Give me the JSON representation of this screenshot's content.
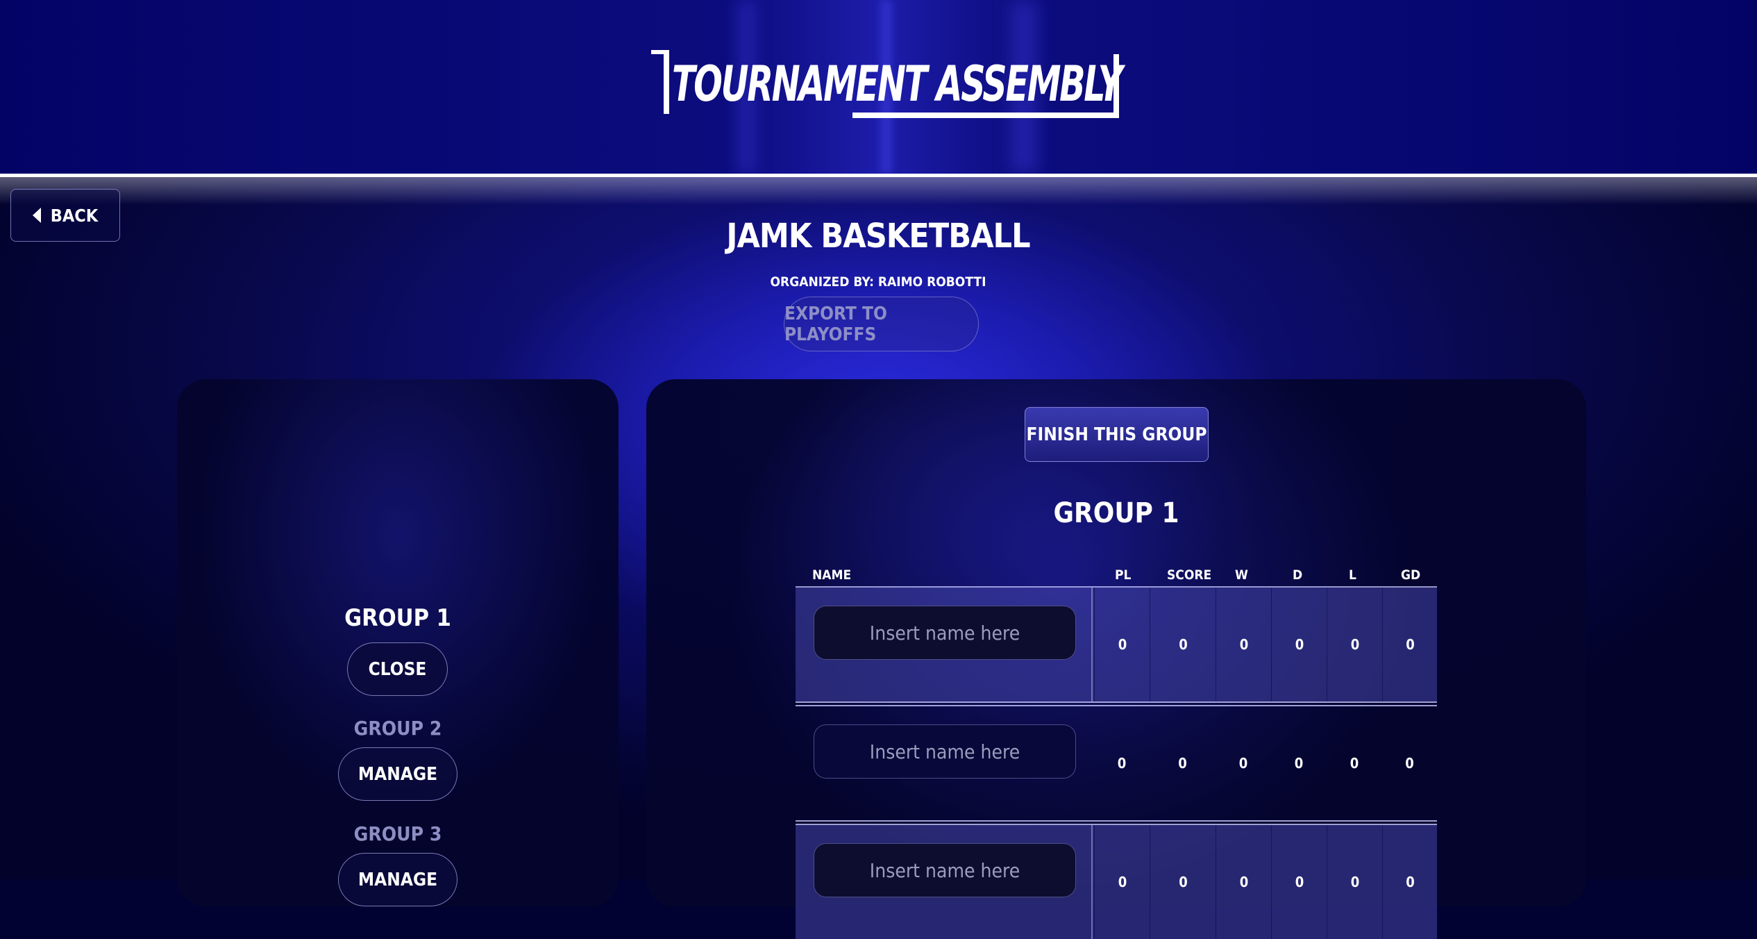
{
  "header": {
    "logo_text": "TOURNAMENT ASSEMBLY"
  },
  "nav": {
    "back_label": "BACK"
  },
  "tournament": {
    "title": "JAMK BASKETBALL",
    "organizer": "ORGANIZED BY: RAIMO ROBOTTI",
    "export_label": "EXPORT TO PLAYOFFS"
  },
  "groups_panel": {
    "groups": [
      {
        "label": "GROUP 1",
        "action": "CLOSE"
      },
      {
        "label": "GROUP 2",
        "action": "MANAGE"
      },
      {
        "label": "GROUP 3",
        "action": "MANAGE"
      }
    ]
  },
  "group_view": {
    "finish_label": "FINISH THIS GROUP",
    "title": "GROUP 1",
    "columns": [
      "NAME",
      "PL",
      "SCORE",
      "W",
      "D",
      "L",
      "GD"
    ],
    "name_placeholder": "Insert name here",
    "rows": [
      {
        "name": "",
        "pl": "0",
        "score": "0",
        "w": "0",
        "d": "0",
        "l": "0",
        "gd": "0"
      },
      {
        "name": "",
        "pl": "0",
        "score": "0",
        "w": "0",
        "d": "0",
        "l": "0",
        "gd": "0"
      },
      {
        "name": "",
        "pl": "0",
        "score": "0",
        "w": "0",
        "d": "0",
        "l": "0",
        "gd": "0"
      }
    ]
  },
  "colors": {
    "header_bg": "#030366",
    "panel_bg": "#04042d",
    "accent": "#2d2de6",
    "muted_text": "#8e8ec4"
  }
}
